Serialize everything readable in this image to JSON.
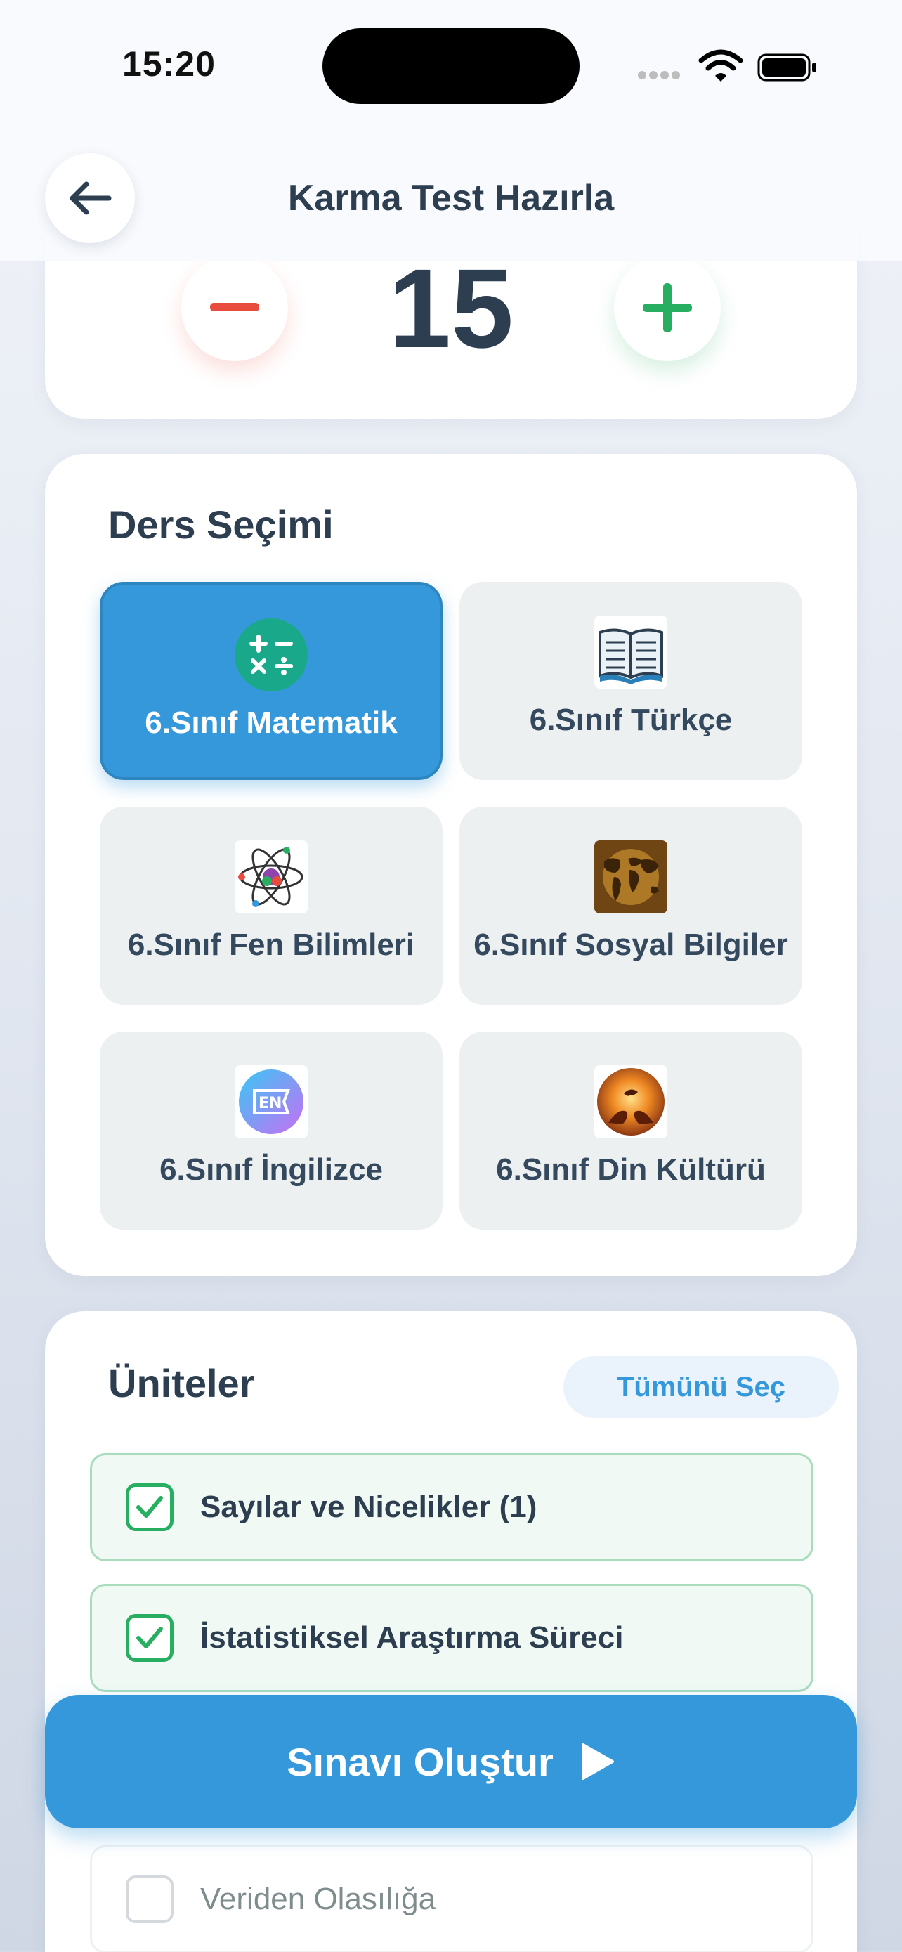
{
  "status_bar": {
    "time": "15:20"
  },
  "header": {
    "title": "Karma Test Hazırla"
  },
  "counter": {
    "value": "15"
  },
  "subjects": {
    "title": "Ders Seçimi",
    "items": [
      {
        "label": "6.Sınıf Matematik",
        "icon": "math-operations-icon",
        "selected": true
      },
      {
        "label": "6.Sınıf Türkçe",
        "icon": "open-book-icon",
        "selected": false
      },
      {
        "label": "6.Sınıf Fen Bilimleri",
        "icon": "atom-icon",
        "selected": false
      },
      {
        "label": "6.Sınıf Sosyal Bilgiler",
        "icon": "world-map-icon",
        "selected": false
      },
      {
        "label": "6.Sınıf İngilizce",
        "icon": "en-language-icon",
        "selected": false
      },
      {
        "label": "6.Sınıf Din Kültürü",
        "icon": "hands-dove-icon",
        "selected": false
      }
    ]
  },
  "units": {
    "title": "Üniteler",
    "select_all_label": "Tümünü Seç",
    "items": [
      {
        "label": "Sayılar ve Nicelikler (1)",
        "checked": true
      },
      {
        "label": "İstatistiksel Araştırma Süreci",
        "checked": true
      },
      {
        "label": "Veriden Olasılığa",
        "checked": false
      }
    ]
  },
  "cta": {
    "label": "Sınavı Oluştur"
  },
  "colors": {
    "primary": "#3498db",
    "danger": "#e74c3c",
    "success": "#27ae60",
    "text": "#2c3e50"
  }
}
